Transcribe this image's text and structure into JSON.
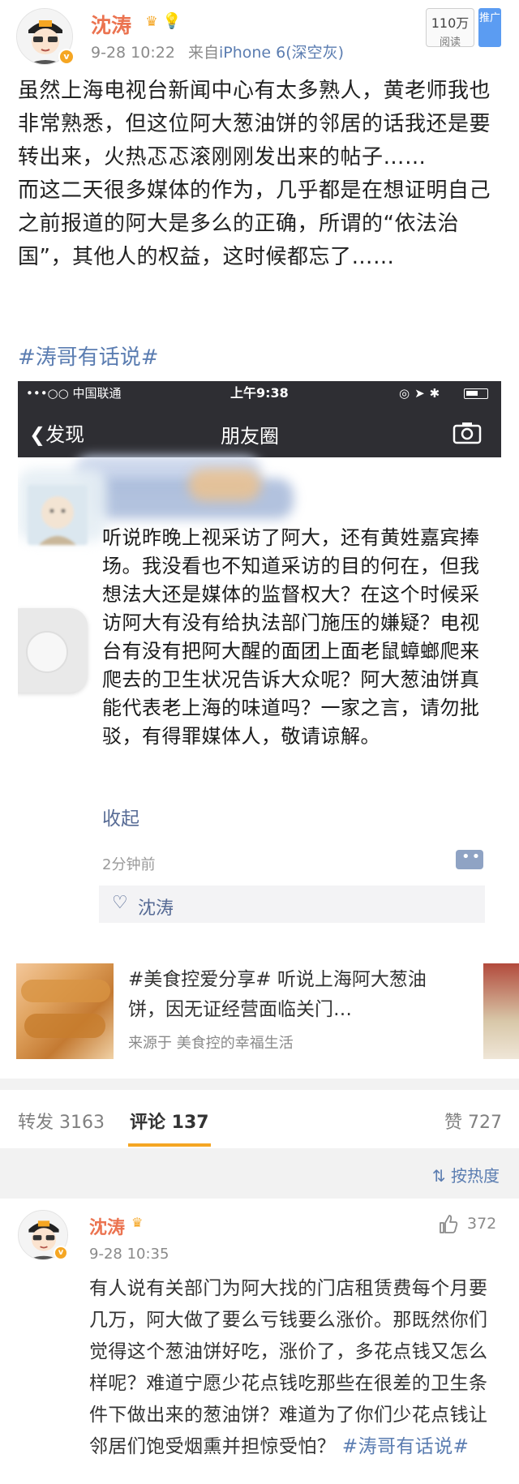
{
  "post": {
    "author": "沈涛",
    "timestamp": "9-28 10:22",
    "source_prefix": "来自",
    "device": "iPhone 6(深空灰)",
    "read_count": "110万",
    "read_label": "阅读",
    "promote_label": "推广",
    "body_p1": "虽然上海电视台新闻中心有太多熟人，黄老师我也非常熟悉，但这位阿大葱油饼的邻居的话我还是要转出来，火热忑忑滚刚刚发出来的帖子……",
    "body_p2": "而这二天很多媒体的作为，几乎都是在想证明自己之前报道的阿大是多么的正确，所谓的“依法治国”，其他人的权益，这时候都忘了……",
    "hashtag": "#涛哥有话说#"
  },
  "screenshot": {
    "carrier": "•••○○ 中国联通",
    "time": "上午9:38",
    "nav_back": "发现",
    "nav_title": "朋友圈",
    "moment_text": "听说昨晚上视采访了阿大，还有黄姓嘉宾捧场。我没看也不知道采访的目的何在，但我想法大还是媒体的监督权大？在这个时候采访阿大有没有给执法部门施压的嫌疑？电视台有没有把阿大醒的面团上面老鼠蟑螂爬来爬去的卫生状况告诉大众呢？阿大葱油饼真能代表老上海的味道吗？一家之言，请勿批驳，有得罪媒体人，敬请谅解。",
    "collapse": "收起",
    "time_ago": "2分钟前",
    "liker": "沈涛"
  },
  "link_card": {
    "title": "#美食控爱分享# 听说上海阿大葱油饼，因无证经营面临关门…",
    "source": "来源于 美食控的幸福生活"
  },
  "tabs": {
    "repost": "转发 3163",
    "comments": "评论 137",
    "likes": "赞 727",
    "sort": "按热度"
  },
  "comment": {
    "author": "沈涛",
    "timestamp": "9-28 10:35",
    "like_count": "372",
    "text": "有人说有关部门为阿大找的门店租赁费每个月要几万，阿大做了要么亏钱要么涨价。那既然你们觉得这个葱油饼好吃，涨价了，多花点钱又怎么样呢？难道宁愿少花点钱吃那些在很差的卫生条件下做出来的葱油饼？难道为了你们少花点钱让邻居们饱受烟熏并担惊受怕？",
    "hashtag": "#涛哥有话说#"
  },
  "colors": {
    "author_orange": "#eb7350",
    "link_blue": "#5b7db1",
    "wechat_blue": "#576b95",
    "tab_accent": "#f5a623"
  }
}
